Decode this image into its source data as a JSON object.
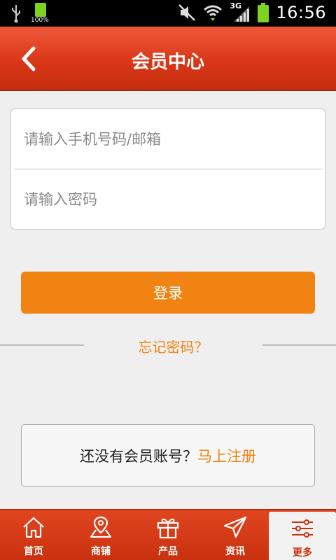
{
  "status_bar": {
    "battery_percent_label": "100%",
    "network_label": "3G",
    "time": "16:56"
  },
  "header": {
    "title": "会员中心"
  },
  "login_form": {
    "account_placeholder": "请输入手机号码/邮箱",
    "password_placeholder": "请输入密码",
    "login_button": "登录",
    "forgot_password": "忘记密码？"
  },
  "register": {
    "prompt": "还没有会员账号？",
    "link": "马上注册"
  },
  "bottom_nav": {
    "items": [
      {
        "label": "首页",
        "icon": "home-icon"
      },
      {
        "label": "商铺",
        "icon": "map-pin-icon"
      },
      {
        "label": "产品",
        "icon": "gift-icon"
      },
      {
        "label": "资讯",
        "icon": "send-icon"
      },
      {
        "label": "更多",
        "icon": "settings-sliders-icon"
      }
    ],
    "active_index": 4
  },
  "colors": {
    "header_red": "#d73515",
    "accent_orange": "#f18312",
    "background": "#efefef"
  }
}
